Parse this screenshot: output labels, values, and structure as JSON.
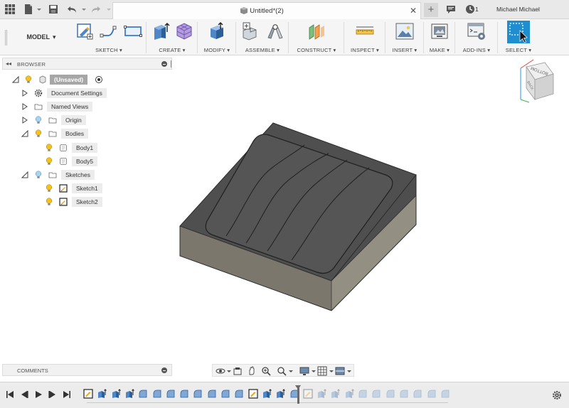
{
  "titlebar": {
    "doc_title": "Untitled*(2)",
    "job_count": "1",
    "user_name": "Michael Michael",
    "icons": [
      "grid-icon",
      "file-icon",
      "save-icon",
      "undo-icon",
      "redo-icon",
      "close-icon",
      "plus-icon",
      "comment-icon",
      "clock-icon"
    ]
  },
  "toolbar": {
    "workspace": "MODEL",
    "groups": [
      {
        "label": "SKETCH ▾"
      },
      {
        "label": "CREATE ▾"
      },
      {
        "label": "MODIFY ▾"
      },
      {
        "label": "ASSEMBLE ▾"
      },
      {
        "label": "CONSTRUCT ▾"
      },
      {
        "label": "INSPECT ▾"
      },
      {
        "label": "INSERT ▾"
      },
      {
        "label": "MAKE ▾"
      },
      {
        "label": "ADD-INS ▾"
      },
      {
        "label": "SELECT ▾"
      }
    ]
  },
  "browser": {
    "title": "BROWSER",
    "root": "(Unsaved)",
    "items": [
      {
        "label": "Document Settings"
      },
      {
        "label": "Named Views"
      },
      {
        "label": "Origin"
      },
      {
        "label": "Bodies"
      },
      {
        "label": "Body1"
      },
      {
        "label": "Body5"
      },
      {
        "label": "Sketches"
      },
      {
        "label": "Sketch1"
      },
      {
        "label": "Sketch2"
      }
    ]
  },
  "comments": {
    "title": "COMMENTS"
  },
  "viewcube": {
    "face_top": "BOTTOM",
    "face_side": "BACK"
  },
  "colors": {
    "select_accent": "#1f8ed1",
    "bulb": "#f5c21b",
    "model_top": "#4a4a4a",
    "model_side": "#7d786e",
    "model_front": "#9b978b"
  }
}
